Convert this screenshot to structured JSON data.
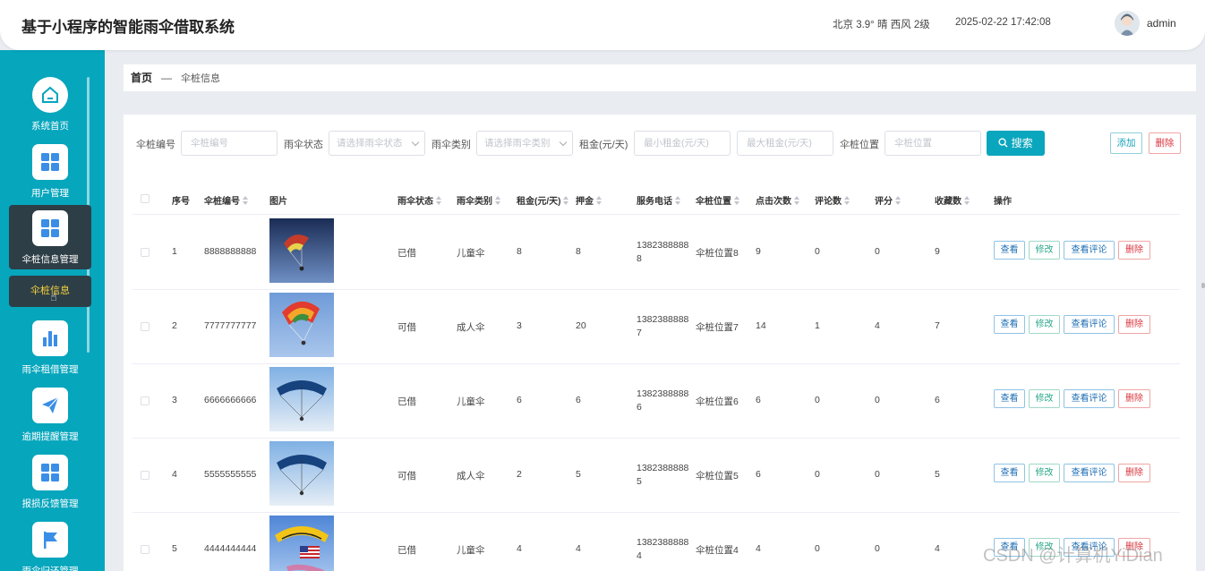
{
  "app": {
    "title": "基于小程序的智能雨伞借取系统"
  },
  "header": {
    "weather": "北京  3.9°  晴  西风  2级",
    "datetime": "2025-02-22 17:42:08",
    "username": "admin"
  },
  "sidebar": {
    "items": [
      {
        "label": "系统首页",
        "icon": "home-icon"
      },
      {
        "label": "用户管理",
        "icon": "grid-icon"
      },
      {
        "label": "伞桩信息管理",
        "icon": "grid-icon"
      },
      {
        "label": "雨伞租借管理",
        "icon": "bar-chart-icon"
      },
      {
        "label": "逾期提醒管理",
        "icon": "paper-plane-icon"
      },
      {
        "label": "报损反馈管理",
        "icon": "grid-icon"
      },
      {
        "label": "雨伞归还管理",
        "icon": "flag-icon"
      }
    ],
    "sub_item": "伞桩信息"
  },
  "breadcrumb": {
    "home": "首页",
    "separator": "—",
    "current": "伞桩信息"
  },
  "search": {
    "pile_no_label": "伞桩编号",
    "pile_no_placeholder": "伞桩编号",
    "status_label": "雨伞状态",
    "status_placeholder": "请选择雨伞状态",
    "type_label": "雨伞类别",
    "type_placeholder": "请选择雨伞类别",
    "rent_label": "租金(元/天)",
    "rent_min_placeholder": "最小租金(元/天)",
    "rent_max_placeholder": "最大租金(元/天)",
    "location_label": "伞桩位置",
    "location_placeholder": "伞桩位置",
    "search_button": "搜索",
    "add_button": "添加",
    "delete_button": "删除"
  },
  "table": {
    "headers": {
      "index": "序号",
      "pile_no": "伞桩编号",
      "image": "图片",
      "status": "雨伞状态",
      "type": "雨伞类别",
      "rent": "租金(元/天)",
      "deposit": "押金",
      "phone": "服务电话",
      "location": "伞桩位置",
      "clicks": "点击次数",
      "comments": "评论数",
      "rating": "评分",
      "favorites": "收藏数",
      "actions": "操作"
    },
    "actions": {
      "view": "查看",
      "edit": "修改",
      "comments": "查看评论",
      "delete": "删除"
    },
    "rows": [
      {
        "index": "1",
        "pile_no": "8888888888",
        "status": "已借",
        "type": "儿童伞",
        "rent": "8",
        "deposit": "8",
        "phone1": "1382388888",
        "phone2": "8",
        "location": "伞桩位置8",
        "clicks": "9",
        "comments": "0",
        "rating": "0",
        "favorites": "9",
        "image": "parachute-dark-sky"
      },
      {
        "index": "2",
        "pile_no": "7777777777",
        "status": "可借",
        "type": "成人伞",
        "rent": "3",
        "deposit": "20",
        "phone1": "1382388888",
        "phone2": "7",
        "location": "伞桩位置7",
        "clicks": "14",
        "comments": "1",
        "rating": "4",
        "favorites": "7",
        "image": "parachute-rainbow"
      },
      {
        "index": "3",
        "pile_no": "6666666666",
        "status": "已借",
        "type": "儿童伞",
        "rent": "6",
        "deposit": "6",
        "phone1": "1382388888",
        "phone2": "6",
        "location": "伞桩位置6",
        "clicks": "6",
        "comments": "0",
        "rating": "0",
        "favorites": "6",
        "image": "parachute-blue"
      },
      {
        "index": "4",
        "pile_no": "5555555555",
        "status": "可借",
        "type": "成人伞",
        "rent": "2",
        "deposit": "5",
        "phone1": "1382388888",
        "phone2": "5",
        "location": "伞桩位置5",
        "clicks": "6",
        "comments": "0",
        "rating": "0",
        "favorites": "5",
        "image": "parachute-blue"
      },
      {
        "index": "5",
        "pile_no": "4444444444",
        "status": "已借",
        "type": "儿童伞",
        "rent": "4",
        "deposit": "4",
        "phone1": "1382388888",
        "phone2": "4",
        "location": "伞桩位置4",
        "clicks": "4",
        "comments": "0",
        "rating": "0",
        "favorites": "4",
        "image": "parachute-yellow-flag"
      }
    ]
  },
  "watermark": "CSDN @计算机YiDian"
}
